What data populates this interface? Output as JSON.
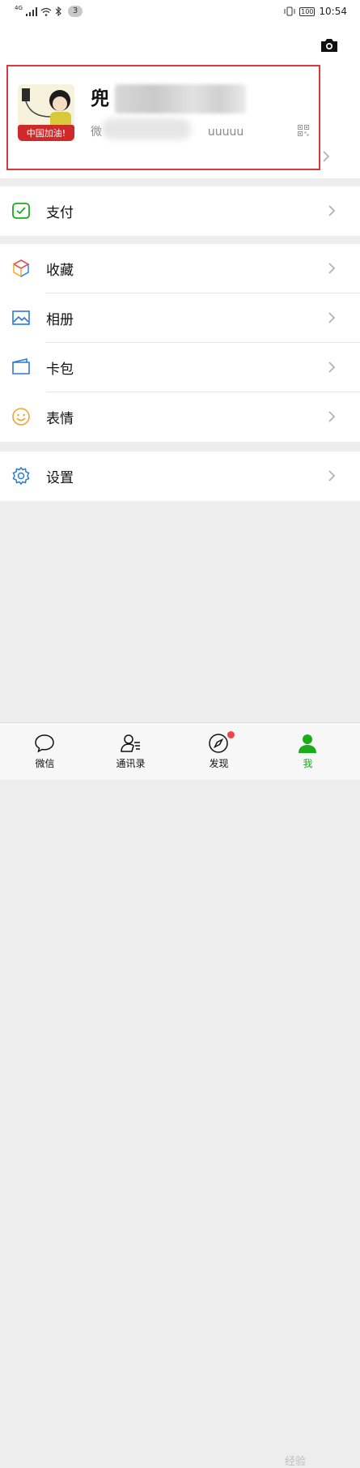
{
  "status_bar": {
    "network": "4G",
    "badge": "3",
    "battery": "100",
    "time": "10:54"
  },
  "profile": {
    "name": "兜",
    "wechat_id": "微",
    "wechat_id_tail": "uuuuu",
    "avatar_caption": "中国加油!"
  },
  "menu": {
    "pay": "支付",
    "favorites": "收藏",
    "album": "相册",
    "cards": "卡包",
    "stickers": "表情",
    "settings": "设置"
  },
  "tabs": [
    {
      "label": "微信",
      "icon": "chat-bubble-icon"
    },
    {
      "label": "通讯录",
      "icon": "contacts-icon"
    },
    {
      "label": "发现",
      "icon": "compass-icon"
    },
    {
      "label": "我",
      "icon": "person-icon"
    }
  ],
  "watermark": "经验",
  "colors": {
    "accent_green": "#1aad19",
    "highlight_red": "#d9393b",
    "badge_red": "#f0454a"
  }
}
